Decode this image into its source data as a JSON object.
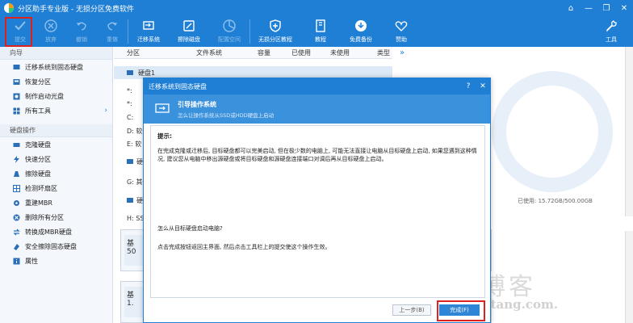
{
  "app": {
    "title": "分区助手专业版 - 无损分区免费软件",
    "window_controls": [
      "⌂",
      "—",
      "❐",
      "✕"
    ]
  },
  "toolbar": {
    "buttons": [
      {
        "label": "提交",
        "icon": "check-icon",
        "enabled": true
      },
      {
        "label": "放弃",
        "icon": "cancel-icon",
        "enabled": false
      },
      {
        "label": "撤销",
        "icon": "undo-icon",
        "enabled": false
      },
      {
        "label": "重做",
        "icon": "redo-icon",
        "enabled": false
      },
      {
        "label": "迁移系统",
        "icon": "migrate-icon",
        "enabled": true
      },
      {
        "label": "擦除磁盘",
        "icon": "wipe-disk-icon",
        "enabled": true
      },
      {
        "label": "配置空间",
        "icon": "pie-icon",
        "enabled": false
      },
      {
        "label": "无损分区教程",
        "icon": "shield-icon",
        "enabled": true
      },
      {
        "label": "教程",
        "icon": "book-icon",
        "enabled": true
      },
      {
        "label": "免费备份",
        "icon": "backup-icon",
        "enabled": true
      },
      {
        "label": "赞助",
        "icon": "heart-icon",
        "enabled": true
      },
      {
        "label": "工具",
        "icon": "wrench-icon",
        "enabled": true
      }
    ]
  },
  "sidebar": {
    "wizard_header": "向导",
    "wizard_items": [
      "迁移系统到固态硬盘",
      "恢复分区",
      "制作启动光盘",
      "所有工具"
    ],
    "disk_header": "硬盘操作",
    "disk_items": [
      "克隆硬盘",
      "快速分区",
      "擦除硬盘",
      "检测坏扇区",
      "重建MBR",
      "删除所有分区",
      "转换成MBR硬盘",
      "安全擦除固态硬盘",
      "属性"
    ]
  },
  "table": {
    "columns": [
      "分区",
      "文件系统",
      "容量",
      "已使用",
      "未使用",
      "类型"
    ],
    "more": "»",
    "rows": [
      {
        "kind": "disk",
        "text": "硬盘1"
      },
      {
        "kind": "part",
        "text": "*:"
      },
      {
        "kind": "part",
        "text": "*:"
      },
      {
        "kind": "part",
        "text": "C:"
      },
      {
        "kind": "part",
        "text": "D: 软件"
      },
      {
        "kind": "part",
        "text": "E: 软"
      },
      {
        "kind": "disk",
        "text": "硬"
      },
      {
        "kind": "part",
        "text": "G: 其他"
      },
      {
        "kind": "disk",
        "text": "硬"
      },
      {
        "kind": "part",
        "text": "H: SSD"
      }
    ]
  },
  "disk_map": {
    "used_label": "已使用: 15.72GB/500.00GB",
    "box1": {
      "name": "基",
      "size": "50"
    },
    "box2": {
      "name": "基",
      "size": "1."
    }
  },
  "dialog": {
    "title": "迁移系统到固态硬盘",
    "controls": [
      "?",
      "✕"
    ],
    "step_title": "引导操作系统",
    "step_desc": "怎么让操作系统从SSD或HDD硬盘上启动",
    "hint_title": "提示:",
    "hint_text": "在完成克隆或迁移后, 目标硬盘都可以完美启动, 但在极少数的电脑上, 可能无法直接让电脑从目标硬盘上启动, 如果您遇到这种情况, 建议您从电脑中移出源硬盘或将目标硬盘和源硬盘连接端口对调后再从目标硬盘上启动。",
    "question": "怎么从目标硬盘启动电脑?",
    "instruction": "点击完成按钮返回主界面, 然后点击工具栏上的提交使这个操作生效。",
    "prev_button": "上一步(B)",
    "finish_button": "完成(F)"
  },
  "watermark": {
    "text": "老唐博客",
    "url": "https://laotang.com."
  }
}
